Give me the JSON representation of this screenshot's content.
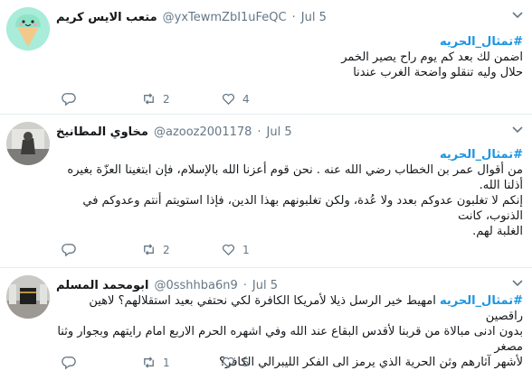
{
  "tweets": [
    {
      "name": "متعب الايس كريم",
      "handle": "@yxTewmZbI1uFeQC",
      "dot": "·",
      "date": "Jul 5",
      "hashtag": "#تمثال_الحريه",
      "lines": [
        "اضمن لك بعد كم يوم راح يصير الخمر",
        "حلال وليه تنقلو واضحة الغرب عندنا"
      ],
      "reply_count": "",
      "retweet_count": "2",
      "like_count": "4"
    },
    {
      "name": "مخاوي المطانيخ",
      "handle": "@azooz2001178",
      "dot": "·",
      "date": "Jul 5",
      "hashtag": "#تمثال_الحريه",
      "lines": [
        "من أقوال عمر بن الخطاب رضي الله عنه . نحن قوم أعزنا الله بالإسلام، فإن ابتغينا العزّة بغيره أذلنا الله.",
        "إنكم لا تغلبون عدوكم بعدد ولا عُدة، ولكن تغلبونهم بهذا الدين، فإذا استويتم أنتم وعدوكم في الذنوب، كانت",
        "الغلبة لهم."
      ],
      "reply_count": "",
      "retweet_count": "2",
      "like_count": "1"
    },
    {
      "name": "ابومحمد المسلم",
      "handle": "@0sshhba6n9",
      "dot": "·",
      "date": "Jul 5",
      "hashtag": "#تمثال_الحريه",
      "lines": [
        "امهيط خير الرسل ذيلا لأمريكا الكافرة لكي نحتفي بعيد استقلالهم؟ لاهين راقصين",
        "بدون ادنى مبالاة من قربنا لأقدس البقاع عند الله وفي اشهره الحرم الاربع امام رايتهم وبجوار وثنا مصغر",
        "لأشهر آثارهم وثن الحرية الذي يرمز الى الفكر الليبرالي الكافر؟"
      ],
      "reply_count": "",
      "retweet_count": "1",
      "like_count": "5"
    }
  ]
}
